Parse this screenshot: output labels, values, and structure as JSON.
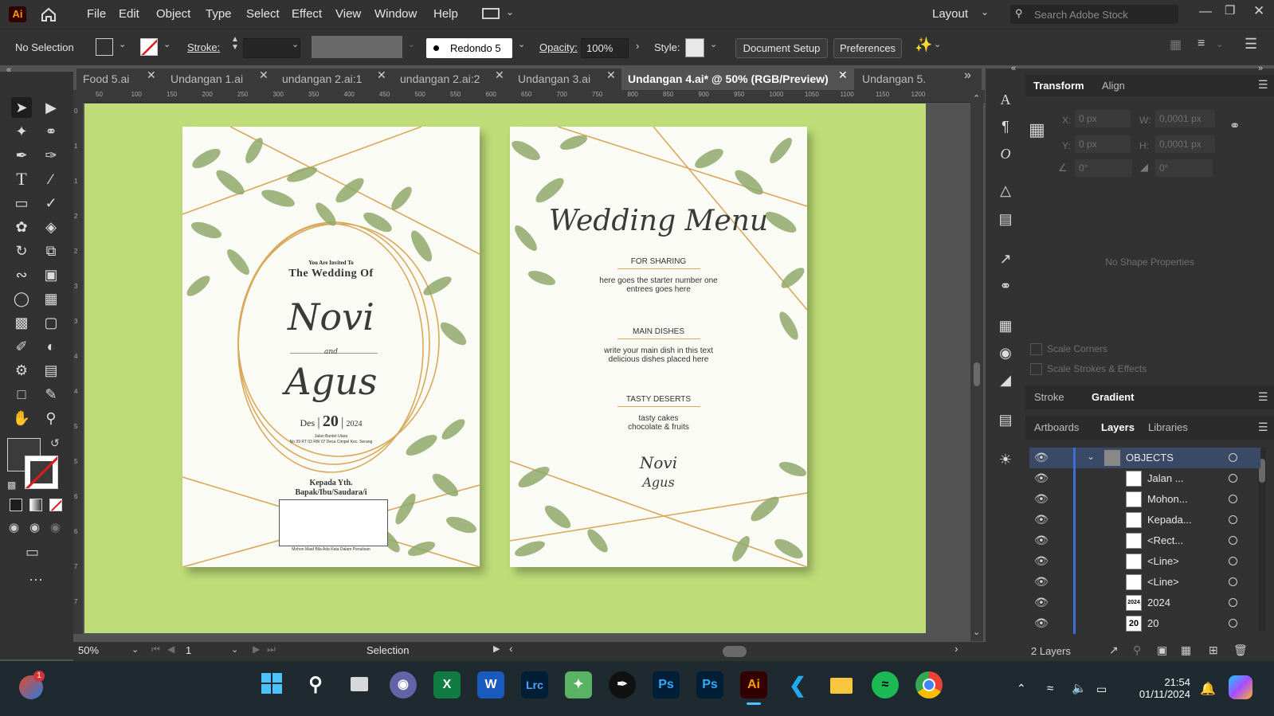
{
  "menubar": {
    "app_logo": "Ai",
    "items": [
      "File",
      "Edit",
      "Object",
      "Type",
      "Select",
      "Effect",
      "View",
      "Window",
      "Help"
    ],
    "workspace": "Layout",
    "search_placeholder": "Search Adobe Stock"
  },
  "control": {
    "selection": "No Selection",
    "stroke_label": "Stroke:",
    "brush": "Redondo 5 ...",
    "opacity_label": "Opacity:",
    "opacity_value": "100%",
    "style_label": "Style:",
    "document_setup": "Document Setup",
    "preferences": "Preferences"
  },
  "tabs": [
    {
      "label": "Food 5.ai"
    },
    {
      "label": "Undangan 1.ai"
    },
    {
      "label": "undangan 2.ai:1"
    },
    {
      "label": "undangan 2.ai:2"
    },
    {
      "label": "Undangan 3.ai"
    },
    {
      "label": "Undangan 4.ai* @ 50% (RGB/Preview)"
    },
    {
      "label": "Undangan 5."
    }
  ],
  "ruler": {
    "h_ticks": [
      "50",
      "100",
      "150",
      "200",
      "250",
      "300",
      "350",
      "400",
      "450",
      "500",
      "550",
      "600",
      "650",
      "700",
      "750",
      "800",
      "850",
      "900",
      "950",
      "1000",
      "1050",
      "1100",
      "1150",
      "1200"
    ],
    "v_ticks": [
      "0",
      "1",
      "1",
      "2",
      "2",
      "3",
      "3",
      "4",
      "4",
      "5",
      "5",
      "6",
      "6",
      "7",
      "7"
    ]
  },
  "invitation": {
    "invited": "You Are Invited To",
    "the_wedding": "The Wedding Of",
    "bride": "Novi",
    "and": "and",
    "groom": "Agus",
    "month": "Des",
    "day": "20",
    "year": "2024",
    "address1": "Jalan Buntet Utara",
    "address2": "No 39 RT 03 RW 07 Desa Cimpel Kec. Serang",
    "to1": "Kepada Yth.",
    "to2": "Bapak/Ibu/Saudara/i",
    "footer": "Mohon Maaf Bila Ada Kata Dalam Penulisan"
  },
  "menu": {
    "title": "Wedding Menu",
    "sections": [
      {
        "heading": "FOR SHARING",
        "line1": "here goes the starter number one",
        "line2": "entrees goes here"
      },
      {
        "heading": "MAIN DISHES",
        "line1": "write your main dish in this text",
        "line2": "delicious dishes placed here"
      },
      {
        "heading": "TASTY DESERTS",
        "line1": "tasty cakes",
        "line2": "chocolate & fruits"
      }
    ],
    "sig1": "Novi",
    "sig2": "Agus"
  },
  "status": {
    "zoom": "50%",
    "artboard": "1",
    "tool": "Selection"
  },
  "panel": {
    "tabs_top": [
      "Transform",
      "Align"
    ],
    "x_label": "X:",
    "x_value": "0 px",
    "y_label": "Y:",
    "y_value": "0 px",
    "w_label": "W:",
    "w_value": "0,0001 px",
    "h_label": "H:",
    "h_value": "0,0001 px",
    "angle": "0°",
    "shear": "0°",
    "no_shape": "No Shape Properties",
    "scale_corners": "Scale Corners",
    "scale_strokes": "Scale Strokes & Effects",
    "tabs_mid": [
      "Stroke",
      "Gradient"
    ],
    "tabs_layers": [
      "Artboards",
      "Layers",
      "Libraries"
    ],
    "layers": [
      {
        "name": "OBJECTS",
        "thumb": ""
      },
      {
        "name": "Jalan ...",
        "thumb": ""
      },
      {
        "name": "Mohon...",
        "thumb": ""
      },
      {
        "name": "Kepada...",
        "thumb": ""
      },
      {
        "name": "<Rect...",
        "thumb": ""
      },
      {
        "name": "<Line>",
        "thumb": ""
      },
      {
        "name": "<Line>",
        "thumb": ""
      },
      {
        "name": "2024",
        "thumb": "2024"
      },
      {
        "name": "20",
        "thumb": "20"
      }
    ],
    "layer_count": "2 Layers"
  },
  "taskbar": {
    "time": "21:54",
    "date": "01/11/2024",
    "notif_badge": "1",
    "apps": [
      "Start",
      "Search",
      "Task View",
      "Teams",
      "Excel",
      "Word",
      "Lrc",
      "Snip",
      "Inkscape",
      "Ps",
      "Ps",
      "Ai",
      "VS Code",
      "Explorer",
      "Spotify",
      "Chrome"
    ]
  },
  "colors": {
    "canvas_green": "#bedd78",
    "gold": "#d8a95a",
    "leaf": "#8fa86a",
    "layer_highlight": "#3b6fd6"
  }
}
